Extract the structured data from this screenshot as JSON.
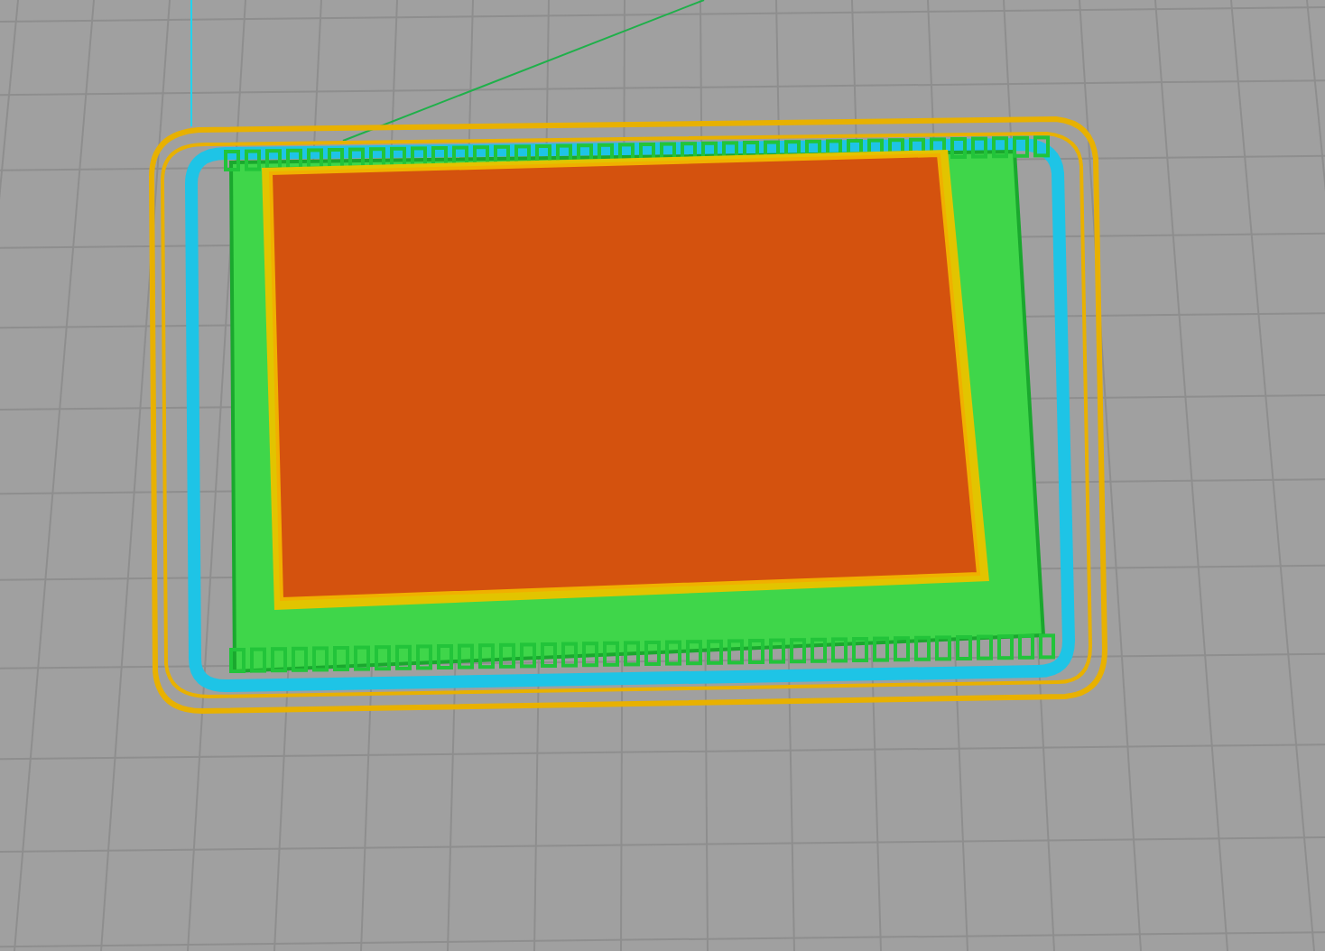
{
  "view": {
    "kind": "layers"
  }
}
